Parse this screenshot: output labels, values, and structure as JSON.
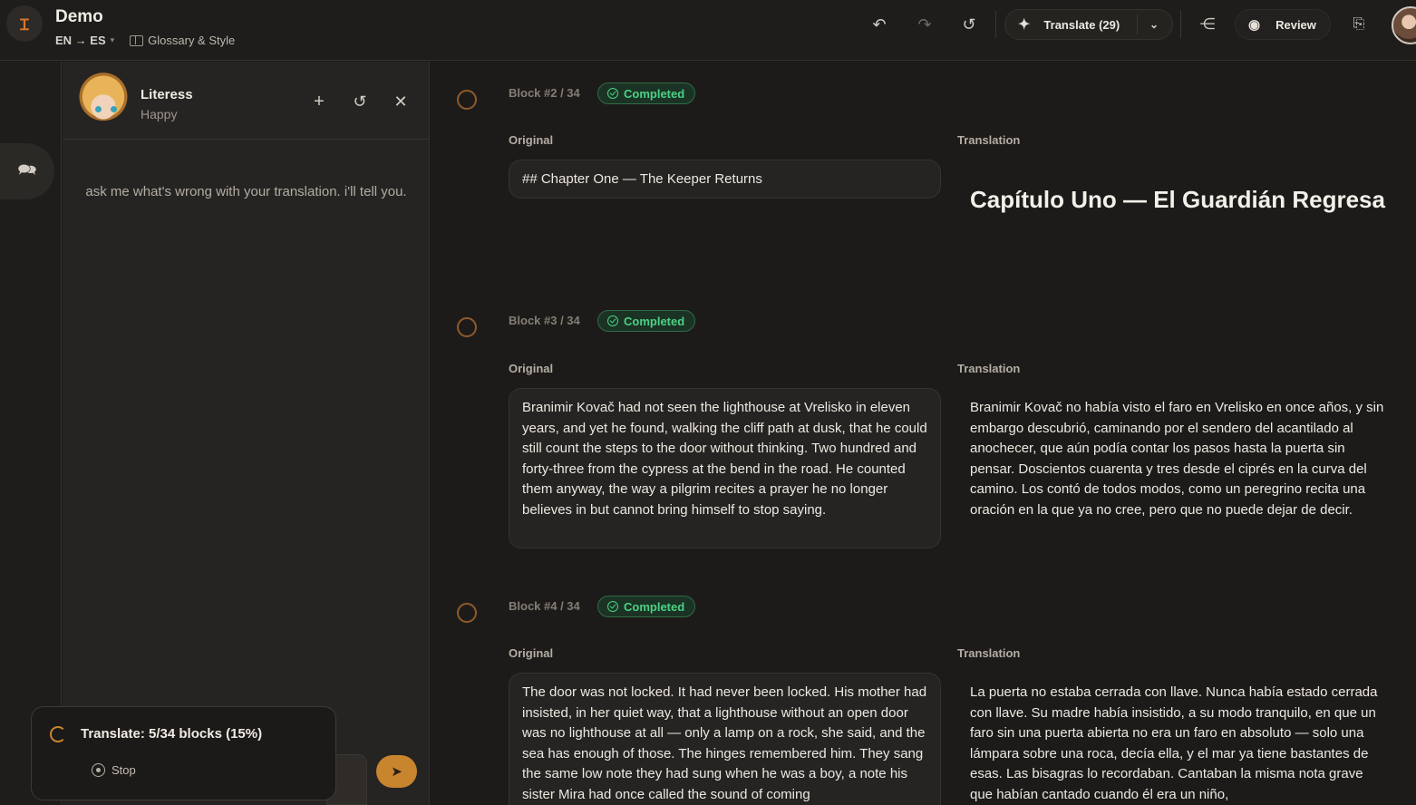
{
  "header": {
    "logo_glyph": "Ɪ",
    "title": "Demo",
    "lang_pair": "EN → ES",
    "glossary_label": "Glossary & Style",
    "translate_label": "Translate (29)",
    "review_label": "Review"
  },
  "chat": {
    "character_name": "Literess",
    "character_mood": "Happy",
    "hint": "ask me what's wrong with your translation. i'll tell you."
  },
  "toast": {
    "progress_text": "Translate: 5/34 blocks (15%)",
    "stop_label": "Stop"
  },
  "labels": {
    "original": "Original",
    "translation": "Translation"
  },
  "blocks": [
    {
      "number": "Block #2 / 34",
      "status": "Completed",
      "original": "## Chapter One — The Keeper Returns",
      "translation": "Capítulo Uno — El Guardián Regresa"
    },
    {
      "number": "Block #3 / 34",
      "status": "Completed",
      "original": "Branimir Kovač had not seen the lighthouse at Vrelisko in eleven years, and yet he found, walking the cliff path at dusk, that he could still count the steps to the door without thinking. Two hundred and forty-three from the cypress at the bend in the road. He counted them anyway, the way a pilgrim recites a prayer he no longer believes in but cannot bring himself to stop saying.",
      "translation": "Branimir Kovač no había visto el faro en Vrelisko en once años, y sin embargo descubrió, caminando por el sendero del acantilado al anochecer, que aún podía contar los pasos hasta la puerta sin pensar. Doscientos cuarenta y tres desde el ciprés en la curva del camino. Los contó de todos modos, como un peregrino recita una oración en la que ya no cree, pero que no puede dejar de decir."
    },
    {
      "number": "Block #4 / 34",
      "status": "Completed",
      "original": "The door was not locked. It had never been locked. His mother had insisted, in her quiet way, that a lighthouse without an open door was no lighthouse at all — only a lamp on a rock, she said, and the sea has enough of those. The hinges remembered him. They sang the same low note they had sung when he was a boy, a note his sister Mira had once called the sound of coming",
      "translation": "La puerta no estaba cerrada con llave. Nunca había estado cerrada con llave. Su madre había insistido, a su modo tranquilo, en que un faro sin una puerta abierta no era un faro en absoluto — solo una lámpara sobre una roca, decía ella, y el mar ya tiene bastantes de esas. Las bisagras lo recordaban. Cantaban la misma nota grave que habían cantado cuando él era un niño,"
    }
  ]
}
